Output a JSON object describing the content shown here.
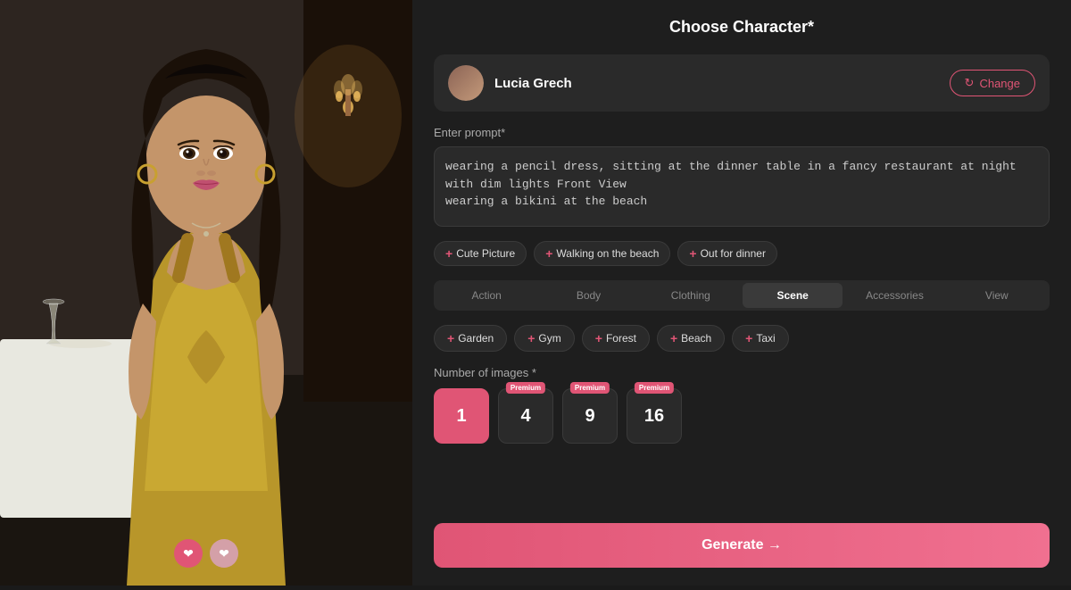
{
  "header": {
    "title": "Choose Character*"
  },
  "character": {
    "name": "Lucia Grech",
    "change_label": "Change"
  },
  "prompt": {
    "label": "Enter prompt*",
    "value": "wearing a pencil dress, sitting at the dinner table in a fancy restaurant at night with dim lights Front View\nwearing a bikini at the beach"
  },
  "quick_tags": [
    {
      "label": "Cute Picture"
    },
    {
      "label": "Walking on the beach"
    },
    {
      "label": "Out for dinner"
    }
  ],
  "tabs": [
    {
      "label": "Action",
      "active": false
    },
    {
      "label": "Body",
      "active": false
    },
    {
      "label": "Clothing",
      "active": false
    },
    {
      "label": "Scene",
      "active": true
    },
    {
      "label": "Accessories",
      "active": false
    },
    {
      "label": "View",
      "active": false
    }
  ],
  "scene_tags": [
    {
      "label": "Garden"
    },
    {
      "label": "Gym"
    },
    {
      "label": "Forest"
    },
    {
      "label": "Beach"
    },
    {
      "label": "Taxi"
    }
  ],
  "num_images": {
    "label": "Number of images *",
    "options": [
      {
        "value": "1",
        "premium": false,
        "selected": true
      },
      {
        "value": "4",
        "premium": true,
        "selected": false
      },
      {
        "value": "9",
        "premium": true,
        "selected": false
      },
      {
        "value": "16",
        "premium": true,
        "selected": false
      }
    ],
    "premium_label": "Premium"
  },
  "generate_button": {
    "label": "Generate →"
  },
  "nav_buttons": {
    "prev": "❤",
    "next": "❤"
  },
  "icons": {
    "refresh": "↻",
    "plus": "+"
  }
}
